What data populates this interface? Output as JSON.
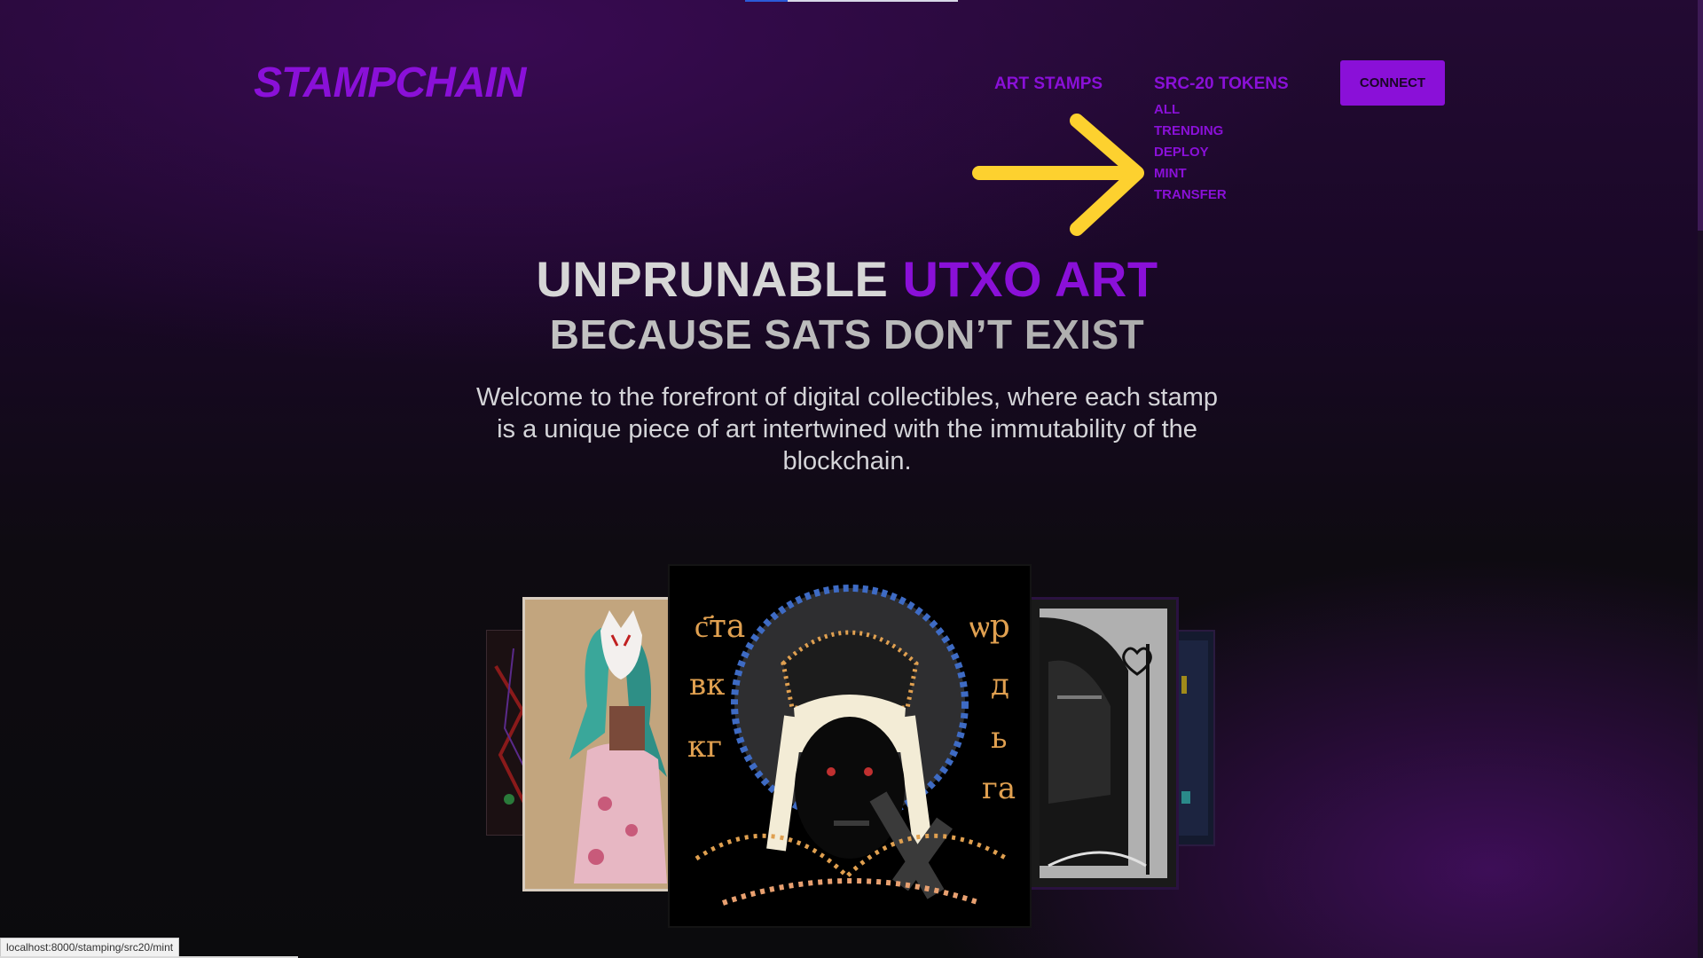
{
  "brand": {
    "logo_text": "STAMPCHAIN",
    "accent_color": "#8a10d8"
  },
  "nav": {
    "art_stamps": "ART STAMPS",
    "src20_tokens": "SRC-20 TOKENS",
    "submenu": [
      {
        "label": "ALL"
      },
      {
        "label": "TRENDING"
      },
      {
        "label": "DEPLOY"
      },
      {
        "label": "MINT"
      },
      {
        "label": "TRANSFER"
      }
    ],
    "connect": "CONNECT"
  },
  "annotation": {
    "arrow_color": "#fdd12f",
    "icon": "arrow-right-icon"
  },
  "hero": {
    "title_main": "UNPRUNABLE ",
    "title_accent": "UTXO ART",
    "subtitle": "BECAUSE SATS DON’T EXIST",
    "description": "Welcome to the forefront of digital collectibles, where each stamp is a unique piece of art intertwined with the immutability of the blockchain."
  },
  "carousel": {
    "cards": [
      {
        "name": "stamp-card-far-left",
        "art": "dark abstract stamp"
      },
      {
        "name": "stamp-card-left",
        "art": "fox-mask anime girl"
      },
      {
        "name": "stamp-card-center",
        "art": "byzantine icon with halo"
      },
      {
        "name": "stamp-card-right",
        "art": "monochrome hooded figure with heart"
      },
      {
        "name": "stamp-card-far-right",
        "art": "dark stamp"
      }
    ]
  },
  "status_bar": {
    "url": "localhost:8000/stamping/src20/mint"
  }
}
